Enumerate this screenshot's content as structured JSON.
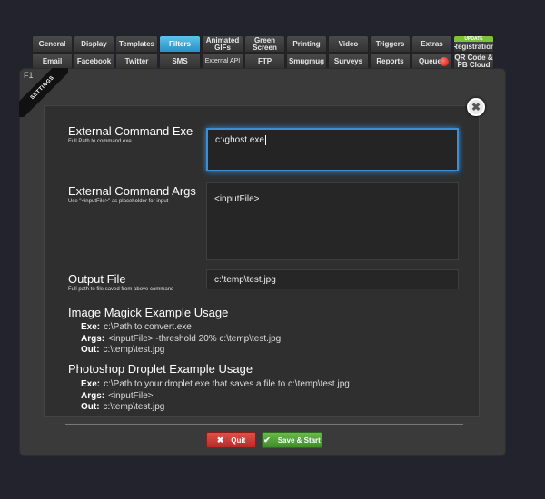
{
  "tabs_row1": [
    {
      "label": "General"
    },
    {
      "label": "Display"
    },
    {
      "label": "Templates"
    },
    {
      "label": "Filters",
      "active": true
    },
    {
      "label": "Animated GIFs"
    },
    {
      "label": "Green Screen"
    },
    {
      "label": "Printing"
    },
    {
      "label": "Video"
    },
    {
      "label": "Triggers"
    },
    {
      "label": "Extras"
    },
    {
      "label": "Registration",
      "badge": "UPDATE"
    }
  ],
  "tabs_row2": [
    {
      "label": "Email"
    },
    {
      "label": "Facebook"
    },
    {
      "label": "Twitter"
    },
    {
      "label": "SMS"
    },
    {
      "label": "External API"
    },
    {
      "label": "FTP"
    },
    {
      "label": "Smugmug"
    },
    {
      "label": "Surveys"
    },
    {
      "label": "Reports"
    },
    {
      "label": "Queue"
    },
    {
      "label": "QR Code & PB Cloud"
    }
  ],
  "ribbon": {
    "key": "F1",
    "label": "SETTINGS"
  },
  "form": {
    "exe_label": "External Command Exe",
    "exe_hint": "Full Path to command exe",
    "exe_value": "c:\\ghost.exe",
    "args_label": "External Command Args",
    "args_hint": "Use \"<inputFile>\" as placeholder for input",
    "args_value": "<inputFile>",
    "output_label": "Output File",
    "output_hint": "Full path to file saved from above command",
    "output_value": "c:\\temp\\test.jpg"
  },
  "examples": {
    "im_title": "Image Magick Example Usage",
    "im_exe_key": "Exe:",
    "im_exe": "c:\\Path to convert.exe",
    "im_args_key": "Args:",
    "im_args": "<inputFile> -threshold 20% c:\\temp\\test.jpg",
    "im_out_key": "Out:",
    "im_out": "c:\\temp\\test.jpg",
    "ps_title": "Photoshop Droplet Example Usage",
    "ps_exe_key": "Exe:",
    "ps_exe": "c:\\Path to your droplet.exe that saves a file to c:\\temp\\test.jpg",
    "ps_args_key": "Args:",
    "ps_args": "<inputFile>",
    "ps_out_key": "Out:",
    "ps_out": "c:\\temp\\test.jpg"
  },
  "buttons": {
    "quit": "Quit",
    "save": "Save & Start"
  },
  "colors": {
    "active_tab": "#2a8fc4",
    "quit": "#c8332e",
    "save": "#52a43a",
    "focus": "#3b8fd6"
  }
}
